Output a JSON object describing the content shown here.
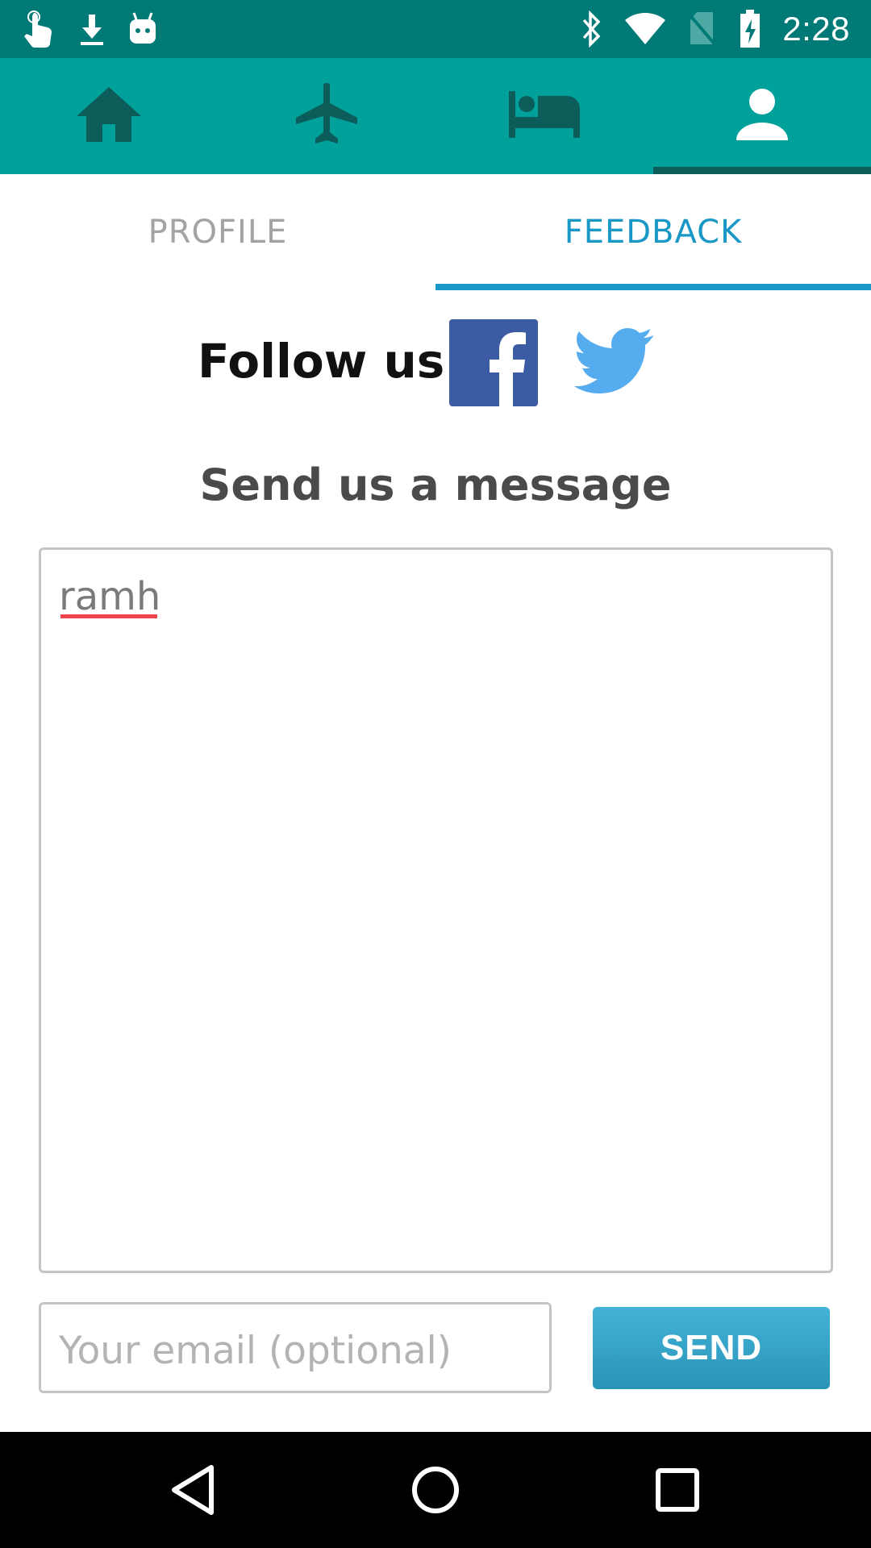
{
  "status_bar": {
    "time": "2:28",
    "left_icons": [
      "touch-app-icon",
      "download-icon",
      "android-icon"
    ],
    "right_icons": [
      "bluetooth-icon",
      "wifi-icon",
      "no-sim-icon",
      "battery-charging-icon"
    ]
  },
  "top_nav": {
    "items": [
      {
        "icon": "home-icon"
      },
      {
        "icon": "airplane-icon"
      },
      {
        "icon": "bed-icon"
      },
      {
        "icon": "person-icon",
        "active": true
      }
    ],
    "colors": {
      "bar": "#00a19a",
      "icon": "#0c5c5a",
      "active_icon": "#ffffff"
    }
  },
  "tabs": {
    "profile": "PROFILE",
    "feedback": "FEEDBACK",
    "active": "FEEDBACK"
  },
  "follow": {
    "label": "Follow us!",
    "icons": [
      "facebook-icon",
      "twitter-icon"
    ]
  },
  "message": {
    "title": "Send us a message",
    "value": "ramh"
  },
  "email": {
    "placeholder": "Your email (optional)",
    "value": ""
  },
  "send_label": "SEND",
  "bottom_nav": {
    "icons": [
      "back-icon",
      "home-circle-icon",
      "recents-icon"
    ]
  },
  "colors": {
    "status_bar": "#007a76",
    "accent": "#1997c6",
    "facebook": "#3b5ba2",
    "twitter": "#55acee",
    "send_button": "#2f9ac0",
    "spell_error": "#f2444f"
  }
}
